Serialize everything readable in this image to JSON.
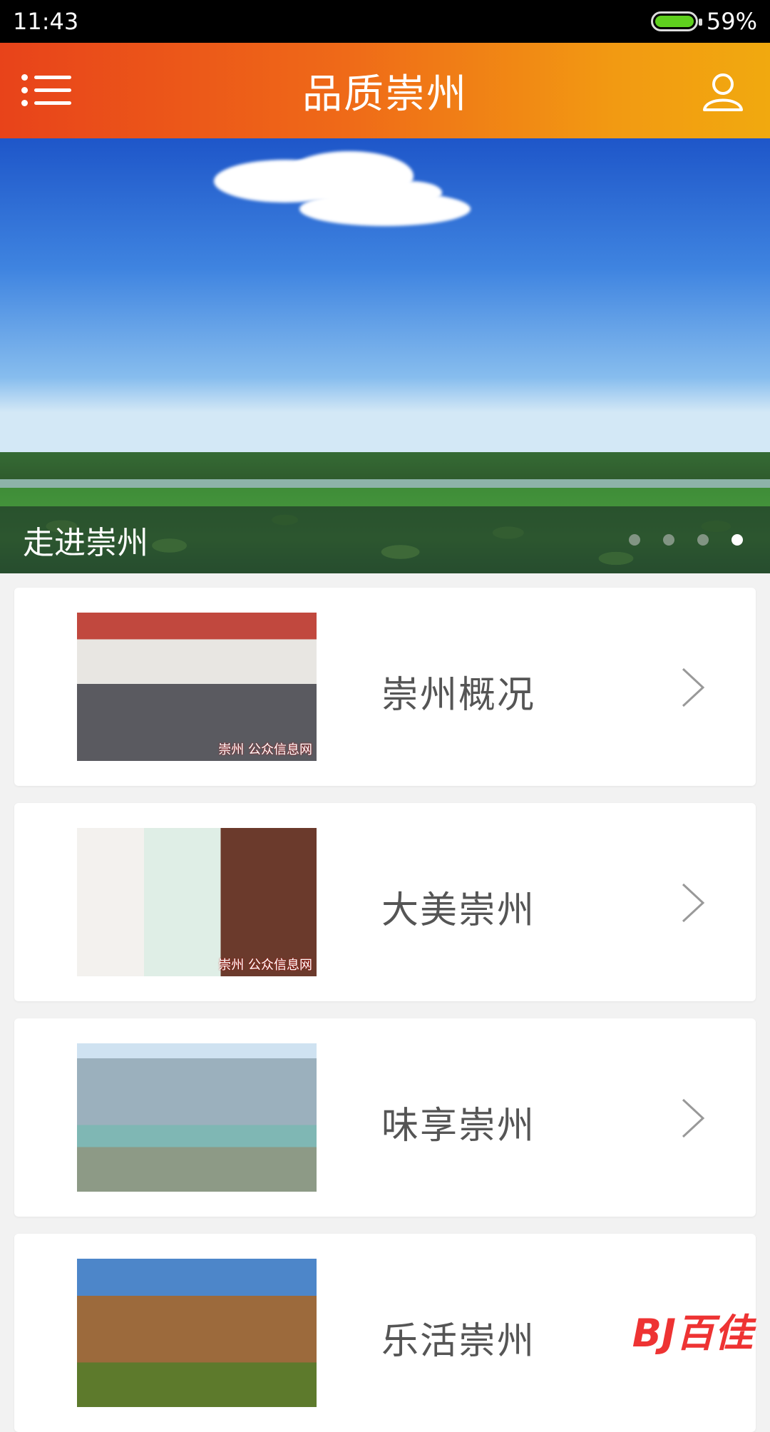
{
  "status_bar": {
    "time": "11:43",
    "battery_percent": "59%",
    "battery_level": 0.59
  },
  "header": {
    "title": "品质崇州",
    "menu_icon": "list-menu-icon",
    "user_icon": "user-icon"
  },
  "banner": {
    "caption": "走进崇州",
    "page_count": 4,
    "active_index": 3
  },
  "list": {
    "items": [
      {
        "label": "崇州概况",
        "thumb_caption": "崇州 公众信息网"
      },
      {
        "label": "大美崇州",
        "thumb_caption": "崇州 公众信息网"
      },
      {
        "label": "味享崇州",
        "thumb_caption": ""
      },
      {
        "label": "乐活崇州",
        "thumb_caption": ""
      }
    ]
  },
  "watermark": "BJ百佳",
  "colors": {
    "header_start": "#e8431a",
    "header_end": "#f1a90f",
    "background": "#f2f2f2"
  }
}
